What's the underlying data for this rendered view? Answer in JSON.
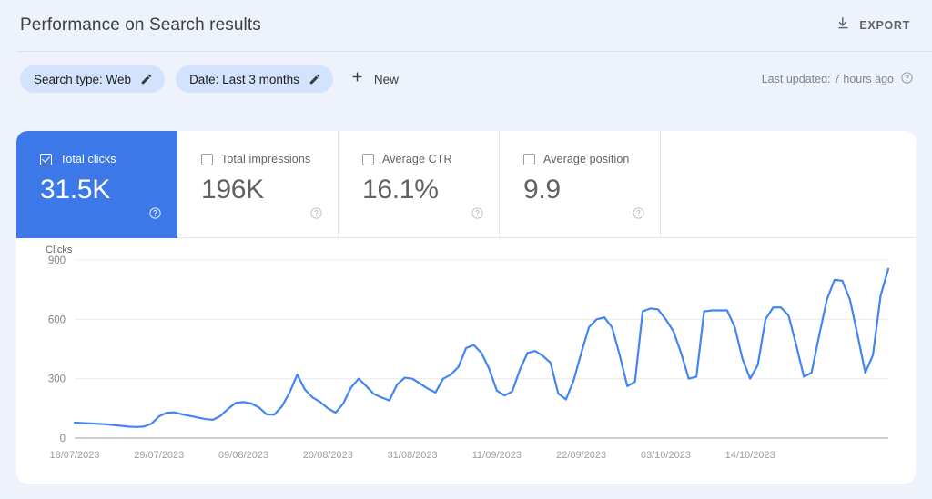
{
  "header": {
    "title": "Performance on Search results",
    "export_label": "EXPORT",
    "export_icon": "download-icon"
  },
  "filters": {
    "chips": [
      {
        "label": "Search type: Web",
        "edit_icon": "pencil-icon"
      },
      {
        "label": "Date: Last 3 months",
        "edit_icon": "pencil-icon"
      }
    ],
    "new_label": "New",
    "new_icon": "plus-icon",
    "last_updated": "Last updated: 7 hours ago",
    "last_updated_icon": "help-icon"
  },
  "metrics": [
    {
      "label": "Total clicks",
      "value": "31.5K",
      "checked": true,
      "help_icon": "help-icon"
    },
    {
      "label": "Total impressions",
      "value": "196K",
      "checked": false,
      "help_icon": "help-icon"
    },
    {
      "label": "Average CTR",
      "value": "16.1%",
      "checked": false,
      "help_icon": "help-icon"
    },
    {
      "label": "Average position",
      "value": "9.9",
      "checked": false,
      "help_icon": "help-icon"
    }
  ],
  "colors": {
    "accent": "#3c78e8",
    "line": "#4285f4",
    "chip_bg": "#d3e3fd",
    "page_bg": "#edf2fb"
  },
  "chart_data": {
    "type": "line",
    "title": "",
    "ylabel": "Clicks",
    "xlabel": "",
    "ylim": [
      0,
      900
    ],
    "yticks": [
      0,
      300,
      600,
      900
    ],
    "grid": true,
    "legend": false,
    "xtick_labels": [
      "18/07/2023",
      "29/07/2023",
      "09/08/2023",
      "20/08/2023",
      "31/08/2023",
      "11/09/2023",
      "22/09/2023",
      "03/10/2023",
      "14/10/2023"
    ],
    "xtick_indices": [
      0,
      11,
      22,
      33,
      44,
      55,
      66,
      77,
      88
    ],
    "series": [
      {
        "name": "Clicks",
        "color": "#4285f4",
        "values": [
          78,
          76,
          74,
          72,
          70,
          66,
          62,
          58,
          56,
          58,
          72,
          110,
          128,
          130,
          120,
          112,
          104,
          96,
          92,
          112,
          148,
          178,
          182,
          175,
          155,
          120,
          118,
          160,
          230,
          320,
          245,
          205,
          182,
          150,
          128,
          175,
          255,
          300,
          262,
          222,
          205,
          190,
          270,
          305,
          300,
          275,
          250,
          230,
          300,
          320,
          360,
          455,
          470,
          430,
          350,
          240,
          215,
          235,
          345,
          430,
          440,
          415,
          380,
          225,
          195,
          290,
          430,
          560,
          600,
          610,
          560,
          420,
          262,
          285,
          640,
          655,
          650,
          600,
          540,
          430,
          300,
          310,
          640,
          645,
          645,
          645,
          560,
          400,
          300,
          370,
          600,
          660,
          660,
          620,
          470,
          310,
          330,
          520,
          700,
          800,
          795,
          700,
          520,
          330,
          420,
          720,
          855
        ]
      }
    ]
  }
}
